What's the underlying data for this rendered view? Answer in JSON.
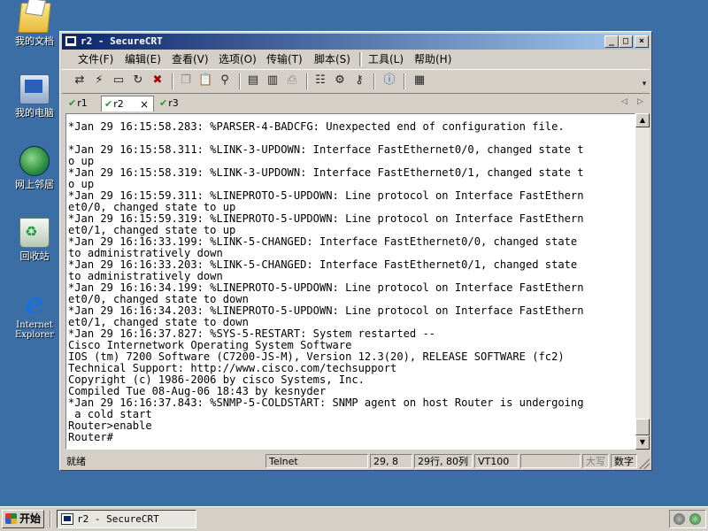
{
  "desktop": {
    "icons": [
      {
        "label": "我的文档"
      },
      {
        "label": "我的电脑"
      },
      {
        "label": "网上邻居"
      },
      {
        "label": "回收站"
      },
      {
        "label": "Internet Explorer"
      }
    ]
  },
  "window": {
    "title": "r2 - SecureCRT",
    "controls": {
      "minimize": "_",
      "maximize": "□",
      "close": "×"
    },
    "menu": [
      "文件(F)",
      "编辑(E)",
      "查看(V)",
      "选项(O)",
      "传输(T)",
      "脚本(S)",
      "工具(L)",
      "帮助(H)"
    ],
    "tabs": [
      {
        "label": "r1",
        "active": false
      },
      {
        "label": "r2",
        "active": true
      },
      {
        "label": "r3",
        "active": false
      }
    ],
    "tab_close": "×",
    "terminal_lines": [
      "*Jan 29 16:15:58.283: %PARSER-4-BADCFG: Unexpected end of configuration file.",
      "",
      "*Jan 29 16:15:58.311: %LINK-3-UPDOWN: Interface FastEthernet0/0, changed state t",
      "o up",
      "*Jan 29 16:15:58.319: %LINK-3-UPDOWN: Interface FastEthernet0/1, changed state t",
      "o up",
      "*Jan 29 16:15:59.311: %LINEPROTO-5-UPDOWN: Line protocol on Interface FastEthern",
      "et0/0, changed state to up",
      "*Jan 29 16:15:59.319: %LINEPROTO-5-UPDOWN: Line protocol on Interface FastEthern",
      "et0/1, changed state to up",
      "*Jan 29 16:16:33.199: %LINK-5-CHANGED: Interface FastEthernet0/0, changed state",
      "to administratively down",
      "*Jan 29 16:16:33.203: %LINK-5-CHANGED: Interface FastEthernet0/1, changed state",
      "to administratively down",
      "*Jan 29 16:16:34.199: %LINEPROTO-5-UPDOWN: Line protocol on Interface FastEthern",
      "et0/0, changed state to down",
      "*Jan 29 16:16:34.203: %LINEPROTO-5-UPDOWN: Line protocol on Interface FastEthern",
      "et0/1, changed state to down",
      "*Jan 29 16:16:37.827: %SYS-5-RESTART: System restarted --",
      "Cisco Internetwork Operating System Software",
      "IOS (tm) 7200 Software (C7200-JS-M), Version 12.3(20), RELEASE SOFTWARE (fc2)",
      "Technical Support: http://www.cisco.com/techsupport",
      "Copyright (c) 1986-2006 by cisco Systems, Inc.",
      "Compiled Tue 08-Aug-06 18:43 by kesnyder",
      "*Jan 29 16:16:37.843: %SNMP-5-COLDSTART: SNMP agent on host Router is undergoing",
      " a cold start",
      "Router>enable",
      "Router#"
    ],
    "status": {
      "state": "就绪",
      "protocol": "Telnet",
      "cursor": "29,  8",
      "size": "29行, 80列",
      "emulation": "VT100",
      "caps": "大写",
      "num": "数字"
    }
  },
  "taskbar": {
    "start_label": "开始",
    "task_label": "r2 - SecureCRT"
  }
}
